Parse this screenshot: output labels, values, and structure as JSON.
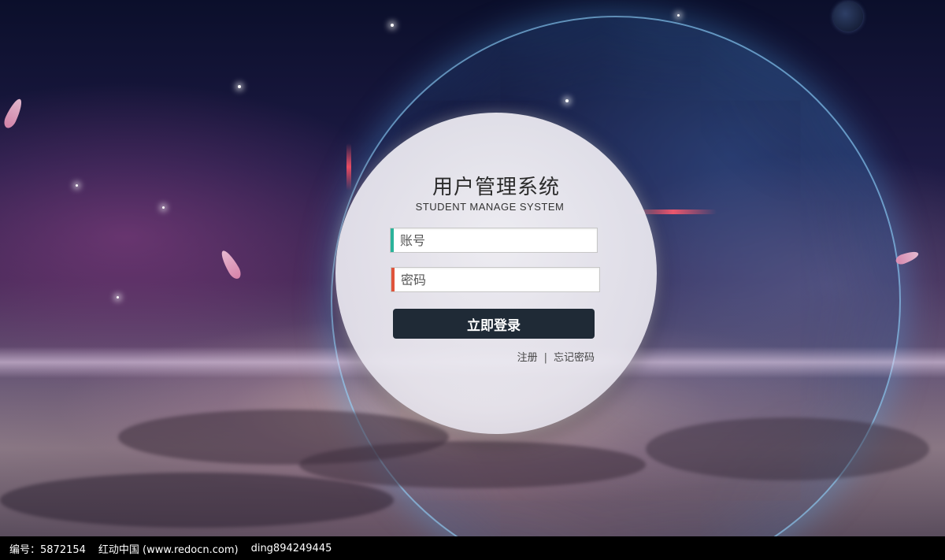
{
  "login": {
    "title": "用户管理系统",
    "subtitle": "STUDENT MANAGE SYSTEM",
    "account_placeholder": "账号",
    "password_placeholder": "密码",
    "submit_label": "立即登录",
    "register_link": "注册",
    "separator": "|",
    "forgot_link": "忘记密码",
    "account_accent": "#2bb39b",
    "password_accent": "#e0543c"
  },
  "watermark": {
    "id_text": "编号：5872154",
    "site_text": "红动中国 (www.redocn.com)",
    "author_text": "ding894249445"
  }
}
